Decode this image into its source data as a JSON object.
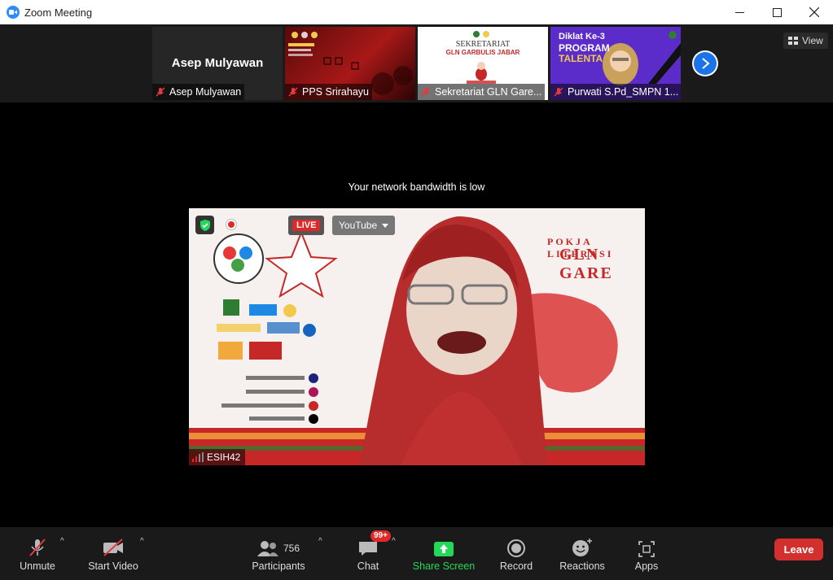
{
  "window": {
    "title": "Zoom Meeting"
  },
  "strip": {
    "view_label": "View",
    "tiles": [
      {
        "name": "Asep Mulyawan",
        "display_name": "Asep Mulyawan"
      },
      {
        "name": "PPS Srirahayu"
      },
      {
        "name": "Sekretariat GLN Gare...",
        "poster_title": "SEKRETARIAT",
        "poster_subtitle": "GLN GARBULIS JABAR"
      },
      {
        "name": "Purwati S.Pd_SMPN 1...",
        "poster_line1": "Diklat Ke-3",
        "poster_line2": "PROGRAM",
        "poster_line3": "TALENTA"
      }
    ]
  },
  "notice": "Your network bandwidth is low",
  "main_video": {
    "live_label": "LIVE",
    "youtube_label": "YouTube",
    "speaker_name": "ESIH42",
    "banner_title": "POKJA LITERASI",
    "banner_subtitle": "GLN GARE"
  },
  "toolbar": {
    "unmute": "Unmute",
    "start_video": "Start Video",
    "participants": "Participants",
    "participants_count": "756",
    "chat": "Chat",
    "chat_badge": "99+",
    "share_screen": "Share Screen",
    "record": "Record",
    "reactions": "Reactions",
    "apps": "Apps",
    "leave": "Leave"
  },
  "colors": {
    "accent": "#2D8CFF",
    "share_green": "#23d959",
    "leave_red": "#d32f2f",
    "live_red": "#e02828"
  }
}
